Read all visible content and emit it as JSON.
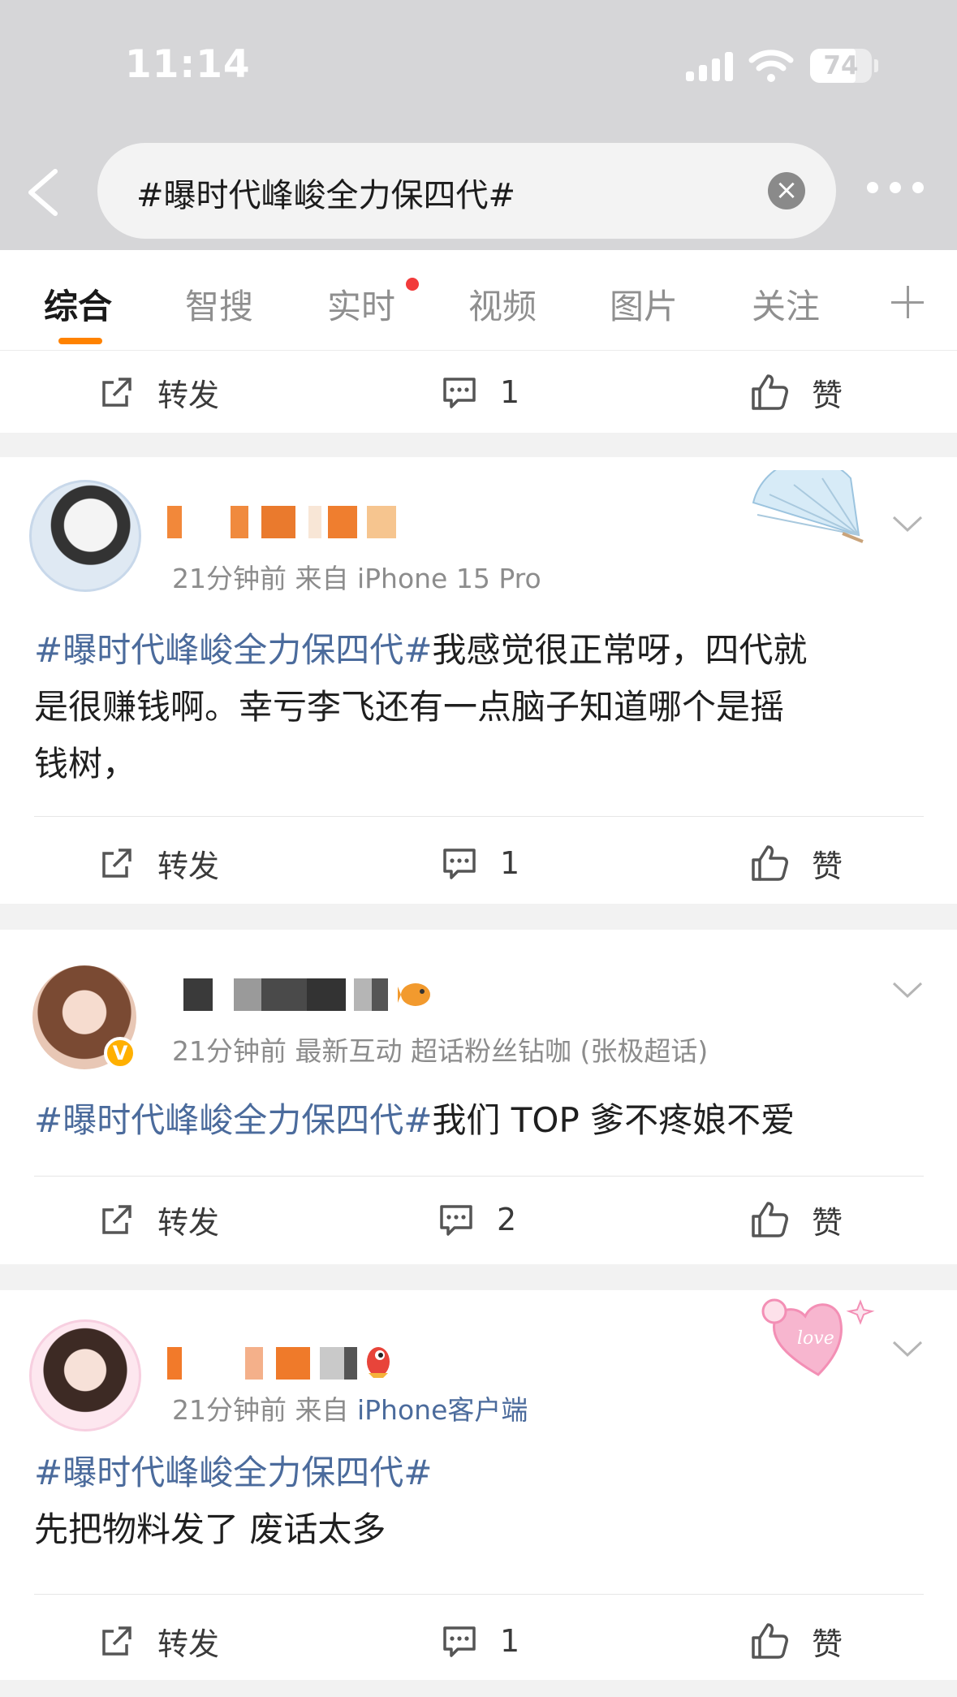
{
  "status_bar": {
    "time": "11:14",
    "battery": "74"
  },
  "search": {
    "query": "#曝时代峰峻全力保四代#"
  },
  "tabs": [
    {
      "label": "综合"
    },
    {
      "label": "智搜"
    },
    {
      "label": "实时"
    },
    {
      "label": "视频"
    },
    {
      "label": "图片"
    },
    {
      "label": "关注"
    }
  ],
  "actions": {
    "repost": "转发",
    "like": "赞"
  },
  "top_partial": {
    "comments": "1"
  },
  "posts": [
    {
      "meta": "21分钟前  来自 iPhone 15 Pro",
      "topic": "#曝时代峰峻全力保四代#",
      "body_line1": "我感觉很正常呀，四代就",
      "body_line2": "是很赚钱啊。幸亏李飞还有一点脑子知道哪个是摇",
      "body_line3": "钱树，",
      "comments": "1"
    },
    {
      "meta": "21分钟前  最新互动  超话粉丝钻咖 (张极超话)",
      "topic": "#曝时代峰峻全力保四代#",
      "body_line1": "我们 TOP 爹不疼娘不爱",
      "comments": "2"
    },
    {
      "meta_prefix": "21分钟前  来自 ",
      "meta_source": "iPhone客户端",
      "topic": "#曝时代峰峻全力保四代#",
      "body_line1": "先把物料发了 废话太多",
      "comments": "1"
    }
  ],
  "colors": {
    "accent": "#ff8200",
    "topic": "#4b6b9c",
    "notice_dot": "#f23b3b"
  }
}
